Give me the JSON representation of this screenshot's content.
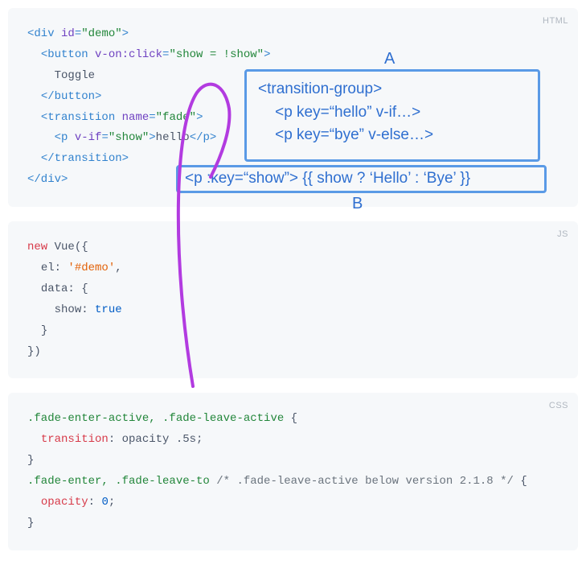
{
  "blocks": {
    "html": {
      "label": "HTML",
      "l1_open": "<div ",
      "l1_attr": "id",
      "l1_eq": "=",
      "l1_val": "\"demo\"",
      "l1_close": ">",
      "l2_open": "<button ",
      "l2_attr": "v-on:click",
      "l2_eq": "=",
      "l2_val": "\"show = !show\"",
      "l2_close": ">",
      "l3_text": "Toggle",
      "l4_close": "</button>",
      "l5_open": "<transition ",
      "l5_attr": "name",
      "l5_eq": "=",
      "l5_val": "\"fade\"",
      "l5_close": ">",
      "l6_open": "<p ",
      "l6_attr": "v-if",
      "l6_eq": "=",
      "l6_val": "\"show\"",
      "l6_mid": ">",
      "l6_text": "hello",
      "l6_close": "</p>",
      "l7_close": "</transition>",
      "l8_close": "</div>"
    },
    "js": {
      "label": "JS",
      "l1_new": "new",
      "l1_vue": " Vue({",
      "l2_el": "el: ",
      "l2_val": "'#demo'",
      "l2_comma": ",",
      "l3_data": "data: {",
      "l4_show": "show: ",
      "l4_true": "true",
      "l5_close": "}",
      "l6_close": "})"
    },
    "css": {
      "label": "CSS",
      "l1_sel": ".fade-enter-active, .fade-leave-active",
      "l1_brace": " {",
      "l2_prop": "transition",
      "l2_val": ": opacity .5s;",
      "l3_close": "}",
      "l4_sel": ".fade-enter, .fade-leave-to",
      "l4_comment": " /* .fade-leave-active below version 2.1.8 */ ",
      "l4_brace": "{",
      "l5_prop": "opacity",
      "l5_colon": ": ",
      "l5_val": "0",
      "l5_semi": ";",
      "l6_close": "}"
    }
  },
  "annotations": {
    "a": {
      "label": "A",
      "line1": "<transition-group>",
      "line2": "    <p key=“hello” v-if…>",
      "line3": "    <p key=“bye” v-else…>"
    },
    "b": {
      "label": "B",
      "line1": "<p :key=“show”> {{ show ? ‘Hello’ : ‘Bye’ }}"
    }
  }
}
